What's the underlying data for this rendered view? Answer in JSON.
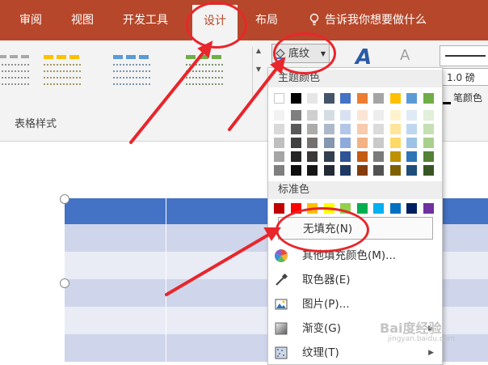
{
  "tabs": [
    {
      "label": "审阅"
    },
    {
      "label": "视图"
    },
    {
      "label": "开发工具"
    },
    {
      "label": "设计"
    },
    {
      "label": "布局"
    }
  ],
  "tell_me": "告诉我你想要做什么",
  "ribbon": {
    "group_label": "表格样式",
    "shading_label": "底纹",
    "pen_weight": "1.0 磅",
    "pen_color": "笔颜色"
  },
  "menu": {
    "theme_colors_label": "主题颜色",
    "standard_colors_label": "标准色",
    "theme_colors_top": [
      "#ffffff",
      "#000000",
      "#e7e6e6",
      "#44546a",
      "#4472c4",
      "#ed7d31",
      "#a5a5a5",
      "#ffc000",
      "#5b9bd5",
      "#70ad47"
    ],
    "theme_shades": [
      [
        "#f2f2f2",
        "#7f7f7f",
        "#d0cece",
        "#d6dce4",
        "#d9e2f3",
        "#fbe5d5",
        "#ededed",
        "#fff2cc",
        "#deeaf6",
        "#e2efd9"
      ],
      [
        "#d9d9d9",
        "#595959",
        "#aeabab",
        "#adb9ca",
        "#b4c6e7",
        "#f7cbac",
        "#dbdbdb",
        "#fee599",
        "#bdd7ee",
        "#c5e0b3"
      ],
      [
        "#bfbfbf",
        "#3f3f3f",
        "#757070",
        "#8496b0",
        "#8eaadb",
        "#f4b183",
        "#c9c9c9",
        "#ffd965",
        "#9cc3e5",
        "#a8d08d"
      ],
      [
        "#a5a5a5",
        "#262626",
        "#3a3838",
        "#323f4f",
        "#2f5496",
        "#c55a11",
        "#7b7b7b",
        "#bf9000",
        "#2e75b5",
        "#538135"
      ],
      [
        "#7f7f7f",
        "#0d0d0d",
        "#171616",
        "#222a35",
        "#1f3864",
        "#843c0b",
        "#525252",
        "#7f6000",
        "#1e4e79",
        "#375623"
      ]
    ],
    "standard_colors": [
      "#c00000",
      "#ff0000",
      "#ffc000",
      "#ffff00",
      "#92d050",
      "#00b050",
      "#00b0f0",
      "#0070c0",
      "#002060",
      "#7030a0"
    ],
    "items": {
      "no_fill": "无填充(N)",
      "more_colors": "其他填充颜色(M)...",
      "eyedropper": "取色器(E)",
      "picture": "图片(P)...",
      "gradient": "渐变(G)",
      "texture": "纹理(T)"
    }
  },
  "watermark": {
    "brand": "Bai度经验",
    "url": "jingyan.baidu.com"
  }
}
